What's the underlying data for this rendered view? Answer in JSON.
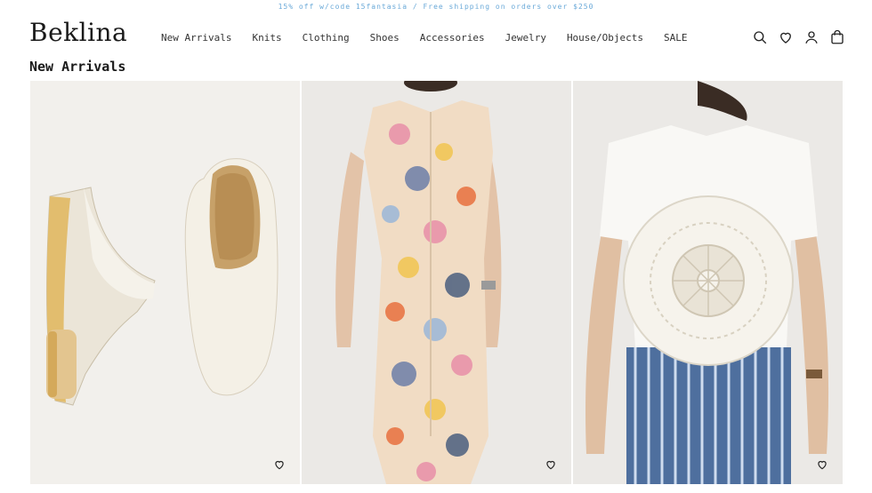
{
  "promo": {
    "text": "15% off w/code 15fantasia / Free shipping on orders over $250"
  },
  "header": {
    "logo": "Beklina",
    "nav": [
      {
        "label": "New Arrivals"
      },
      {
        "label": "Knits"
      },
      {
        "label": "Clothing"
      },
      {
        "label": "Shoes"
      },
      {
        "label": "Accessories"
      },
      {
        "label": "Jewelry"
      },
      {
        "label": "House/Objects"
      },
      {
        "label": "SALE"
      }
    ],
    "icons": [
      "search-icon",
      "heart-icon",
      "account-icon",
      "cart-icon"
    ]
  },
  "main": {
    "title": "New Arrivals",
    "products": [
      {
        "image": "cream leather clogs with wooden heels"
      },
      {
        "image": "multicolor printed sleeveless shirt dress"
      },
      {
        "image": "white tee with crochet doily panel"
      }
    ]
  },
  "colors": {
    "promo": "#6aa9d8",
    "text": "#222222"
  }
}
